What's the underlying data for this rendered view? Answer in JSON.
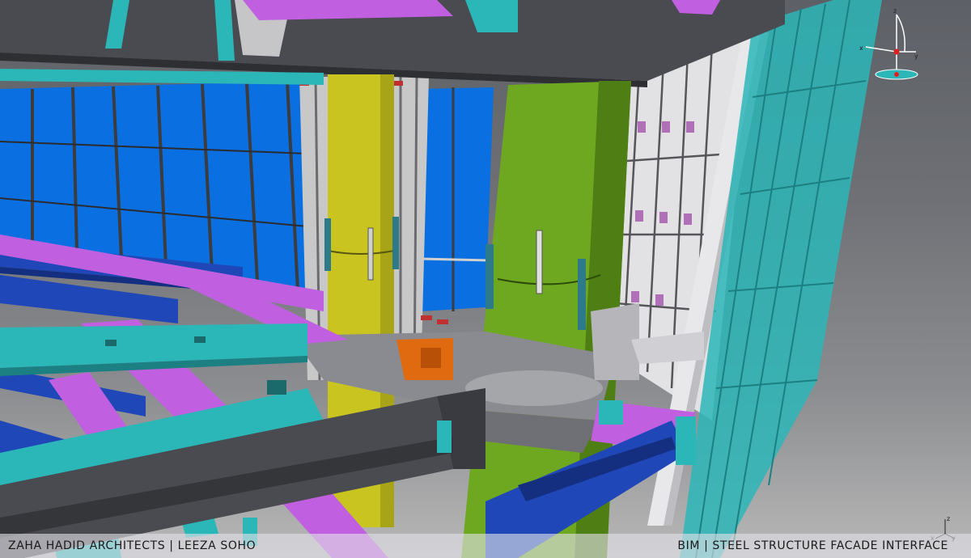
{
  "caption_bar": {
    "left": "ZAHA HADID ARCHITECTS | LEEZA SOHO",
    "right": "BIM | STEEL STRUCTURE FACADE INTERFACE"
  },
  "compass": {
    "axis_z": "z",
    "axis_x": "x",
    "axis_y": "y"
  },
  "mini_axis": {
    "axis_z": "z",
    "axis_x": "x",
    "axis_y": "y"
  },
  "colors": {
    "glass_blue": "#0a6fe0",
    "glazing_teal": "#2bb6b8",
    "beam_gray": "#4a4b50",
    "beam_magenta": "#c060e0",
    "beam_blue": "#1f47b8",
    "column_yellow": "#c9c420",
    "column_green": "#6ea820",
    "gusset_orange": "#e06a10",
    "mullion_light": "#d6d6d6"
  }
}
